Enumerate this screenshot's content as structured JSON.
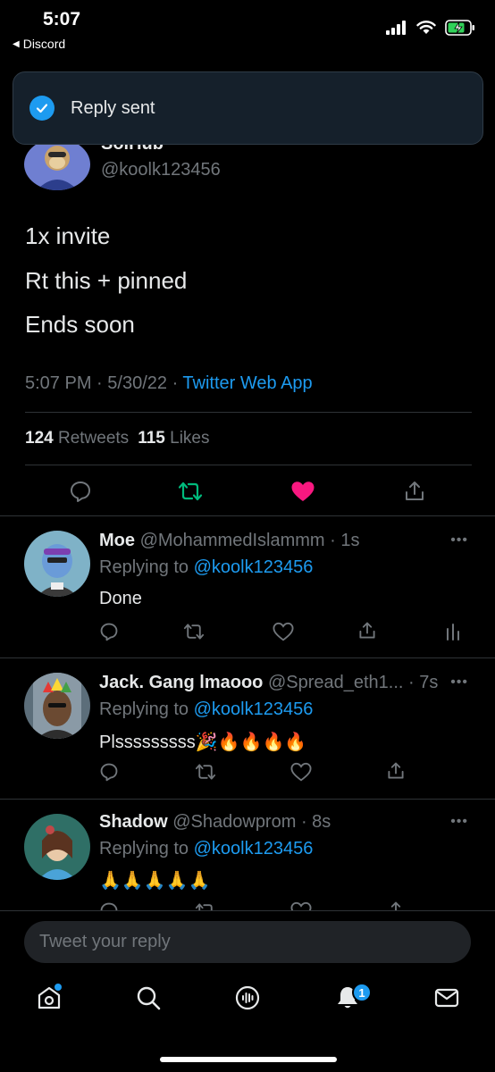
{
  "status_bar": {
    "time": "5:07",
    "back_app": "Discord"
  },
  "toast": {
    "message": "Reply sent"
  },
  "tweet": {
    "author_name": "SolHub",
    "author_handle": "@koolk123456",
    "lines": [
      "1x invite",
      "Rt this + pinned",
      "Ends soon"
    ],
    "time": "5:07 PM",
    "date": "5/30/22",
    "source": "Twitter Web App",
    "retweets_count": "124",
    "retweets_label": "Retweets",
    "likes_count": "115",
    "likes_label": "Likes"
  },
  "replies": [
    {
      "name": "Moe",
      "handle": "@MohammedIslammm",
      "age": "1s",
      "replying_prefix": "Replying to",
      "replying_to": "@koolk123456",
      "text": "Done"
    },
    {
      "name": "Jack. Gang lmaooo",
      "handle": "@Spread_eth1...",
      "age": "7s",
      "replying_prefix": "Replying to",
      "replying_to": "@koolk123456",
      "text": "Plsssssssss🎉🔥🔥🔥🔥"
    },
    {
      "name": "Shadow",
      "handle": "@Shadowprom",
      "age": "8s",
      "replying_prefix": "Replying to",
      "replying_to": "@koolk123456",
      "text": "🙏🙏🙏🙏🙏"
    }
  ],
  "compose": {
    "placeholder": "Tweet your reply"
  },
  "tab_bar": {
    "notifications_badge": "1"
  },
  "colors": {
    "accent": "#1d9bf0",
    "like": "#f91880",
    "retweet": "#00ba7c",
    "background": "#000000"
  }
}
